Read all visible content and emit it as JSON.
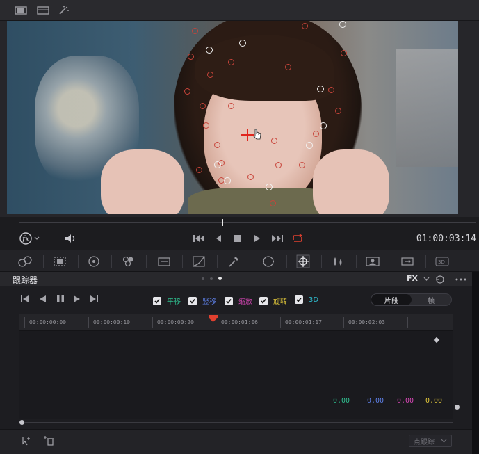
{
  "topbar": {
    "icons": [
      "single-viewer-icon",
      "dual-viewer-icon",
      "magic-wand-icon"
    ]
  },
  "transport": {
    "fx_menu": "fx-icon",
    "timecode": "01:00:03:14"
  },
  "tools": [
    "color-wheels-icon",
    "curves-grid-icon",
    "primary-wheel-icon",
    "rgb-mixer-icon",
    "motion-icon",
    "curves-icon",
    "qualifier-icon",
    "window-icon",
    "tracker-icon",
    "blur-icon",
    "key-icon",
    "sizing-icon",
    "3d-icon"
  ],
  "tracker_panel": {
    "title": "跟踪器",
    "fx_label": "FX",
    "checkboxes": [
      {
        "label": "平移",
        "color": "#2fbf8f"
      },
      {
        "label": "竖移",
        "color": "#5d7fe6"
      },
      {
        "label": "缩放",
        "color": "#d646b5"
      },
      {
        "label": "旋转",
        "color": "#e0c63a"
      },
      {
        "label": "3D",
        "color": "#2fbfd2"
      }
    ],
    "segment": {
      "clip": "片段",
      "frame": "帧"
    },
    "ruler_ticks": [
      "00:00:00:00",
      "00:00:00:10",
      "00:00:00:20",
      "00:00:01:06",
      "00:00:01:17",
      "00:00:02:03"
    ],
    "values": [
      {
        "value": "0.00",
        "color": "#2fbf8f"
      },
      {
        "value": "0.00",
        "color": "#5d7fe6"
      },
      {
        "value": "0.00",
        "color": "#d646b5"
      },
      {
        "value": "0.00",
        "color": "#e0c63a"
      }
    ],
    "dropdown": "点跟踪"
  }
}
